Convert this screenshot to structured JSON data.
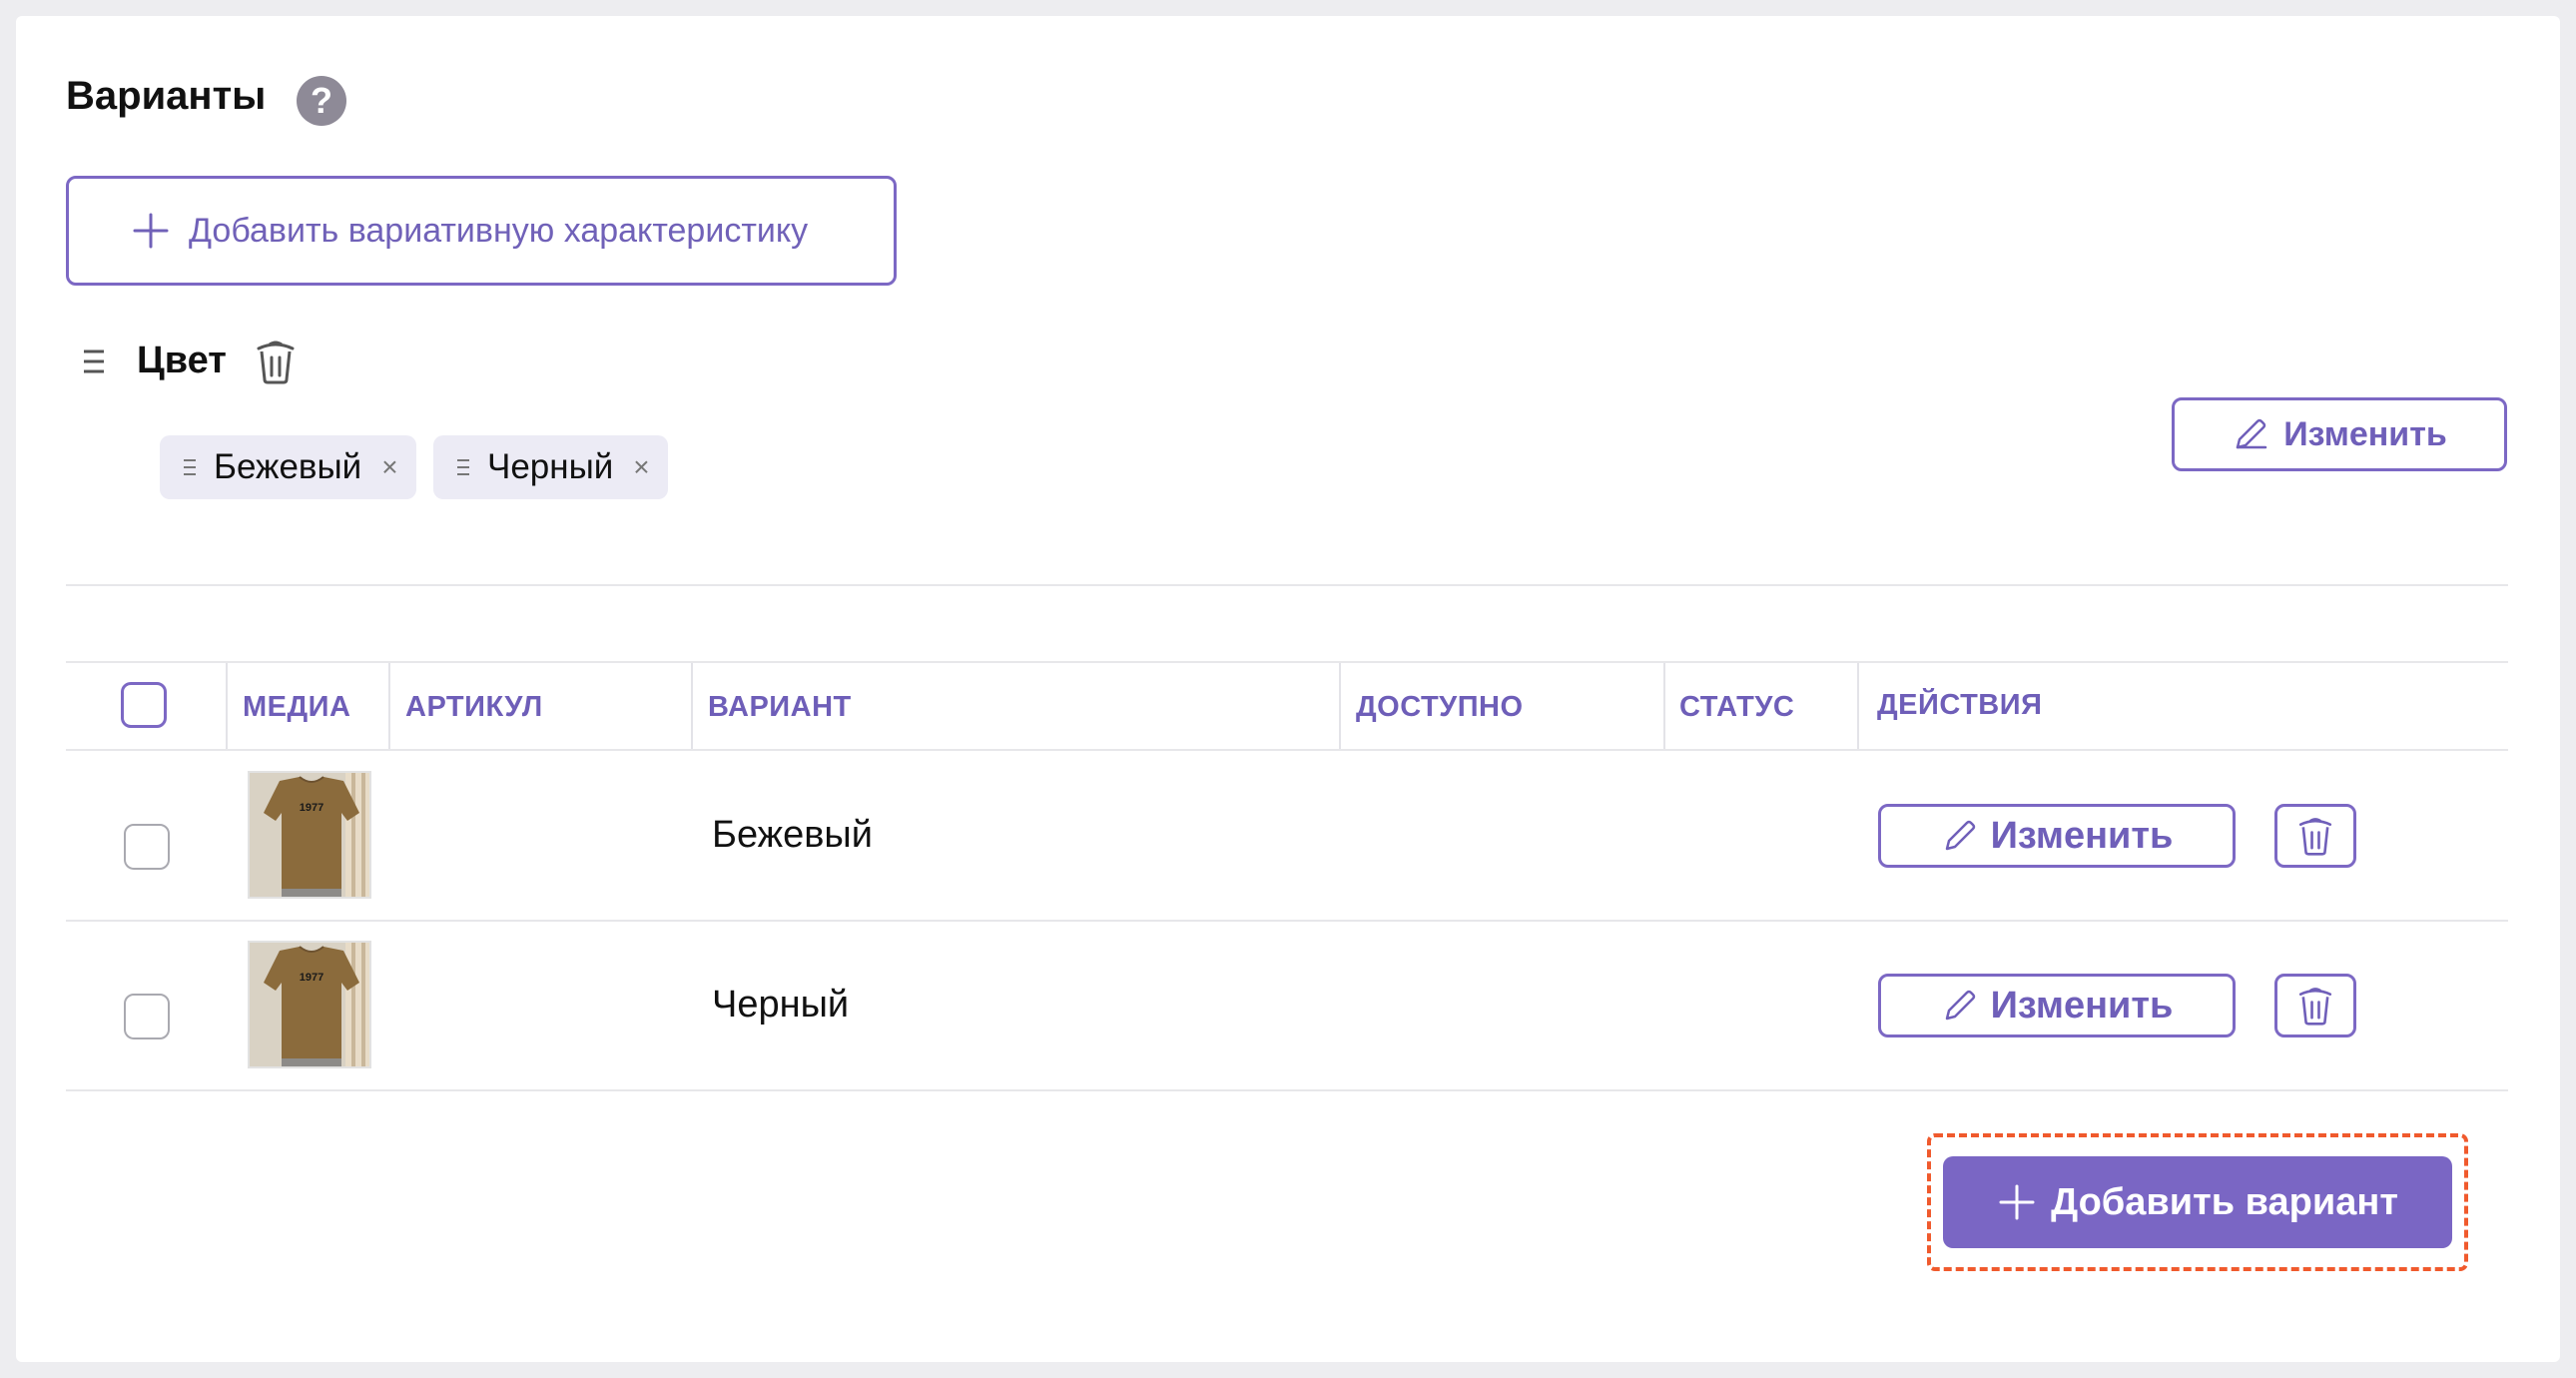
{
  "section": {
    "title": "Варианты",
    "help_glyph": "?"
  },
  "add_attribute_button": {
    "label": "Добавить вариативную характеристику"
  },
  "attribute": {
    "name": "Цвет",
    "values": [
      {
        "label": "Бежевый",
        "remove": "×"
      },
      {
        "label": "Черный",
        "remove": "×"
      }
    ],
    "edit_label": "Изменить"
  },
  "table": {
    "columns": [
      "МЕДИА",
      "АРТИКУЛ",
      "ВАРИАНТ",
      "ДОСТУПНО",
      "СТАТУС",
      "ДЕЙСТВИЯ"
    ],
    "rows": [
      {
        "article": "",
        "variant": "Бежевый",
        "available": "",
        "status": "",
        "edit_label": "Изменить",
        "thumb_text": "1977"
      },
      {
        "article": "",
        "variant": "Черный",
        "available": "",
        "status": "",
        "edit_label": "Изменить",
        "thumb_text": "1977"
      }
    ]
  },
  "add_variant_button": {
    "label": "Добавить вариант"
  },
  "colors": {
    "accent": "#7a66c4",
    "highlight": "#f05a2d",
    "chip_bg": "#ecebf5"
  },
  "icons": [
    "help-icon",
    "plus-icon",
    "drag-handle-icon",
    "trash-icon",
    "close-icon",
    "pencil-icon"
  ]
}
